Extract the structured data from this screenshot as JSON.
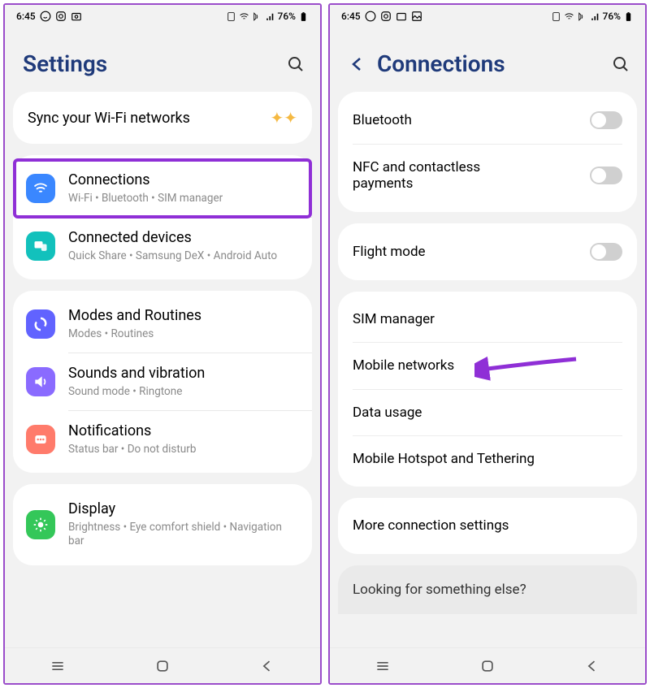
{
  "statusbar": {
    "time": "6:45",
    "battery": "76%"
  },
  "left": {
    "title": "Settings",
    "promo": "Sync your Wi-Fi networks",
    "groups": [
      {
        "items": [
          {
            "title": "Connections",
            "sub": "Wi-Fi  •  Bluetooth  •  SIM manager"
          },
          {
            "title": "Connected devices",
            "sub": "Quick Share  •  Samsung DeX  •  Android Auto"
          }
        ]
      },
      {
        "items": [
          {
            "title": "Modes and Routines",
            "sub": "Modes  •  Routines"
          },
          {
            "title": "Sounds and vibration",
            "sub": "Sound mode  •  Ringtone"
          },
          {
            "title": "Notifications",
            "sub": "Status bar  •  Do not disturb"
          }
        ]
      },
      {
        "items": [
          {
            "title": "Display",
            "sub": "Brightness  •  Eye comfort shield  •  Navigation bar"
          }
        ]
      }
    ]
  },
  "right": {
    "title": "Connections",
    "groups": [
      {
        "items": [
          {
            "title": "Bluetooth",
            "toggle": true
          },
          {
            "title": "NFC and contactless payments",
            "toggle": true
          }
        ]
      },
      {
        "items": [
          {
            "title": "Flight mode",
            "toggle": true
          }
        ]
      },
      {
        "items": [
          {
            "title": "SIM manager",
            "toggle": false
          },
          {
            "title": "Mobile networks",
            "toggle": false
          },
          {
            "title": "Data usage",
            "toggle": false
          },
          {
            "title": "Mobile Hotspot and Tethering",
            "toggle": false
          }
        ]
      },
      {
        "items": [
          {
            "title": "More connection settings",
            "toggle": false
          }
        ]
      }
    ],
    "help": "Looking for something else?"
  }
}
